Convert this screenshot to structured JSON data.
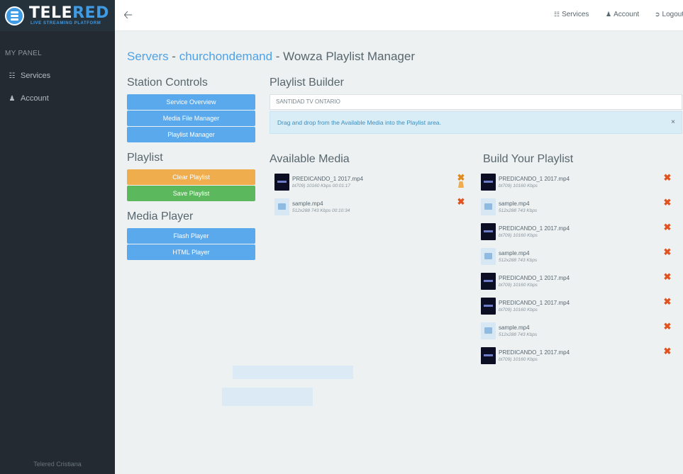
{
  "brand": {
    "name_part1": "TELE",
    "name_part2": "RED",
    "tagline": "LIVE STREAMING PLATFORM"
  },
  "sidebar": {
    "heading": "MY PANEL",
    "items": [
      {
        "label": "Services",
        "icon": "sitemap-icon"
      },
      {
        "label": "Account",
        "icon": "user-icon"
      }
    ],
    "footer": "Telered Cristiana"
  },
  "topbar": {
    "links": [
      {
        "label": "Services",
        "icon": "sitemap-icon"
      },
      {
        "label": "Account",
        "icon": "user-icon"
      },
      {
        "label": "Logout",
        "icon": "sign-out-icon"
      }
    ]
  },
  "breadcrumb": {
    "servers": "Servers",
    "sep1": " - ",
    "server": "churchondemand",
    "sep2": " - ",
    "current": "Wowza Playlist Manager"
  },
  "station_controls": {
    "title": "Station Controls",
    "buttons": [
      "Service Overview",
      "Media File Manager",
      "Playlist Manager"
    ]
  },
  "playlist": {
    "title": "Playlist",
    "clear_label": "Clear Playlist",
    "save_label": "Save Playlist"
  },
  "media_player": {
    "title": "Media Player",
    "buttons": [
      "Flash Player",
      "HTML Player"
    ]
  },
  "playlist_builder": {
    "title": "Playlist Builder",
    "station_value": "SANTIDAD TV ONTARIO",
    "info": "Drag and drop from the Available Media into the Playlist area.",
    "close": "×"
  },
  "available_media": {
    "title": "Available Media",
    "items": [
      {
        "name": "PREDICANDO_1 2017.mp4",
        "meta": "bt709) 10160 Kbps 00:01:17",
        "type": "video"
      },
      {
        "name": "sample.mp4",
        "meta": "512x288 743 Kbps 00:10:34",
        "type": "file"
      }
    ]
  },
  "build_playlist": {
    "title": "Build Your Playlist",
    "items": [
      {
        "name": "PREDICANDO_1 2017.mp4",
        "meta": "bt709) 10160 Kbps",
        "type": "video"
      },
      {
        "name": "sample.mp4",
        "meta": "512x288 743 Kbps",
        "type": "file"
      },
      {
        "name": "PREDICANDO_1 2017.mp4",
        "meta": "bt709) 10160 Kbps",
        "type": "video"
      },
      {
        "name": "sample.mp4",
        "meta": "512x288 743 Kbps",
        "type": "file"
      },
      {
        "name": "PREDICANDO_1 2017.mp4",
        "meta": "bt709) 10160 Kbps",
        "type": "video"
      },
      {
        "name": "PREDICANDO_1 2017.mp4",
        "meta": "bt709) 10160 Kbps",
        "type": "video"
      },
      {
        "name": "sample.mp4",
        "meta": "512x288 743 Kbps",
        "type": "file"
      },
      {
        "name": "PREDICANDO_1 2017.mp4",
        "meta": "bt709) 10160 Kbps",
        "type": "video"
      }
    ]
  },
  "icons": {
    "remove": "remove-icon",
    "back": "arrow-left-icon",
    "video_thumb": "video-thumbnail-icon",
    "file_thumb": "file-thumbnail-icon"
  },
  "colors": {
    "accent": "#5aa9ec",
    "sidebar": "#232a31",
    "warning": "#f0ad4e",
    "success": "#5cb85c",
    "danger": "#e0521e"
  }
}
